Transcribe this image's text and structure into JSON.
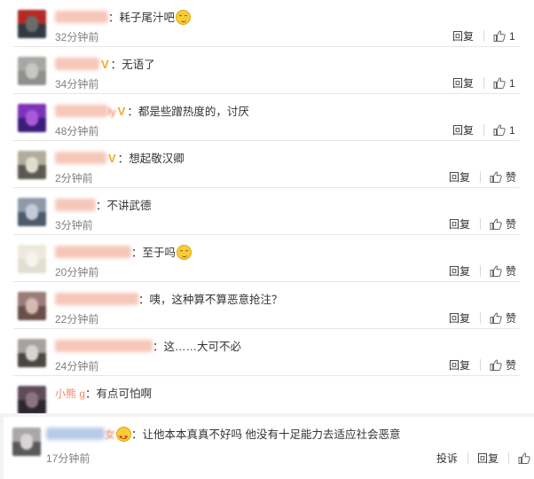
{
  "comments": [
    {
      "name_hint": "",
      "text": "耗子尾汁吧",
      "emoji": "smile",
      "time": "32分钟前",
      "reply": "回复",
      "like": "1",
      "vip": false,
      "avatar": [
        "#b52a25",
        "#2f3a44",
        "#6b6b6b"
      ]
    },
    {
      "name_hint": "",
      "text": "无语了",
      "emoji": "",
      "time": "34分钟前",
      "reply": "回复",
      "like": "1",
      "vip": true,
      "avatar": [
        "#a7a7a3",
        "#8f8f8b",
        "#c9c7c2"
      ]
    },
    {
      "name_hint": "ly",
      "text": "都是些蹭热度的，讨厌",
      "emoji": "",
      "time": "48分钟前",
      "reply": "回复",
      "like": "1",
      "vip": true,
      "avatar": [
        "#7b33b8",
        "#3a1c7a",
        "#a85ad7"
      ]
    },
    {
      "name_hint": "",
      "text": "想起敬汉卿",
      "emoji": "",
      "time": "2分钟前",
      "reply": "回复",
      "like": "赞",
      "vip": true,
      "avatar": [
        "#b1ad9a",
        "#5a5a52",
        "#e0ddd1"
      ]
    },
    {
      "name_hint": "",
      "text": "不讲武德",
      "emoji": "",
      "time": "3分钟前",
      "reply": "回复",
      "like": "赞",
      "vip": false,
      "avatar": [
        "#8f9aa8",
        "#4d5a6a",
        "#c3ccd6"
      ]
    },
    {
      "name_hint": "",
      "text": "至于吗",
      "emoji": "smile",
      "time": "20分钟前",
      "reply": "回复",
      "like": "赞",
      "vip": false,
      "avatar": [
        "#ede9dc",
        "#e2dfd2",
        "#f6f3ea"
      ]
    },
    {
      "name_hint": "",
      "text": "咦，这种算不算恶意抢注？",
      "emoji": "",
      "time": "22分钟前",
      "reply": "回复",
      "like": "赞",
      "vip": false,
      "avatar": [
        "#9b7d78",
        "#6a4e4a",
        "#d5b9b3"
      ]
    },
    {
      "name_hint": "",
      "text": "这……大可不必",
      "emoji": "",
      "time": "24分钟前",
      "reply": "回复",
      "like": "赞",
      "vip": false,
      "avatar": [
        "#a5a2a0",
        "#4b4642",
        "#d8d4d0"
      ]
    },
    {
      "name_hint": "小熊 g",
      "text": "有点可怕啊",
      "emoji": "",
      "time": "",
      "reply": "",
      "like": "",
      "vip": false,
      "avatar": [
        "#5e4c5a",
        "#2d2530",
        "#8a7584"
      ]
    }
  ],
  "bottom_comment": {
    "name_hint": "女",
    "text": "让他本本真真不好吗 他没有十足能力去适应社会恶意",
    "emoji": "heart",
    "time": "17分钟前",
    "report": "投诉",
    "reply": "回复",
    "avatar": [
      "#a9a7a8",
      "#5b5859",
      "#d8d5d6"
    ]
  },
  "colors": {
    "name": "#eb7350",
    "vip": "#f6a623",
    "time": "#808080",
    "separator": "#e6e6e6"
  },
  "icons": {
    "like": "thumbs-up-icon",
    "vip": "vip-badge-icon",
    "emoji": "emoji-icon"
  }
}
